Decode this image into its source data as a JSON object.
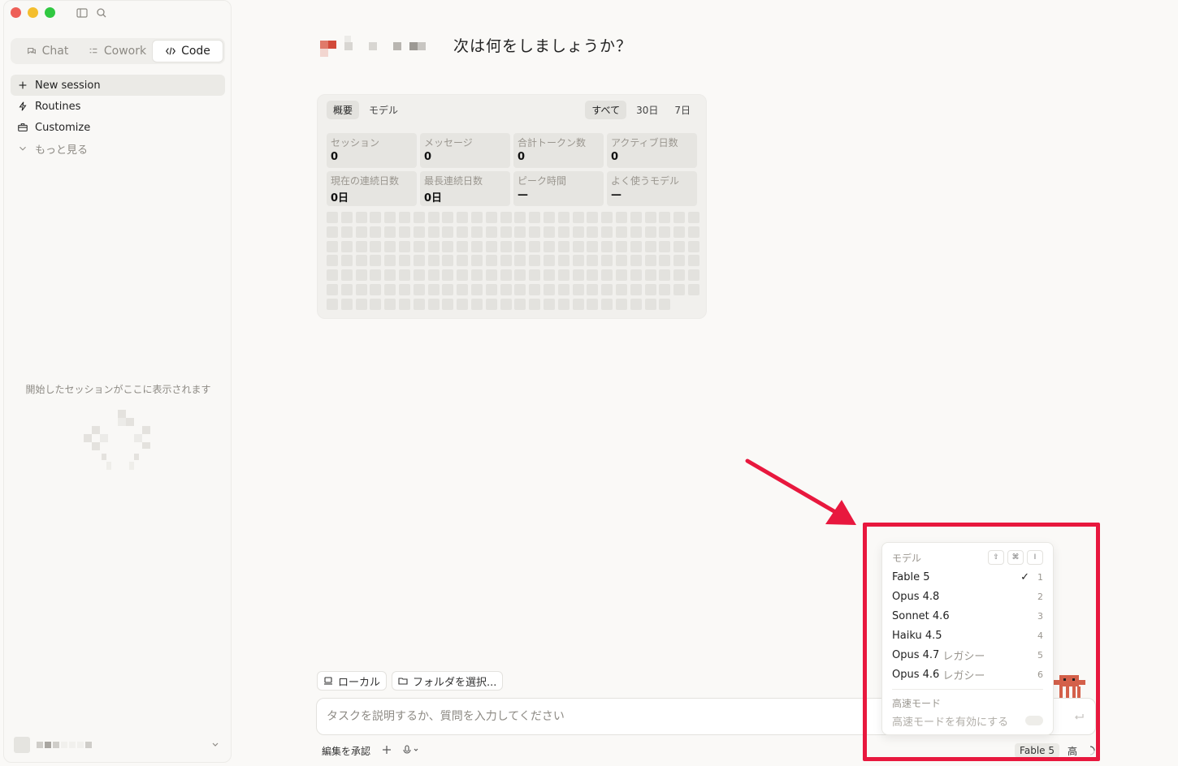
{
  "sidebar": {
    "tabs": [
      {
        "label": "Chat",
        "icon": "chat-icon"
      },
      {
        "label": "Cowork",
        "icon": "cowork-icon"
      },
      {
        "label": "Code",
        "icon": "code-icon"
      }
    ],
    "nav": [
      {
        "label": "New session",
        "icon": "plus-icon"
      },
      {
        "label": "Routines",
        "icon": "bolt-icon"
      },
      {
        "label": "Customize",
        "icon": "briefcase-icon"
      },
      {
        "label": "もっと見る",
        "icon": "chevron-down-icon"
      }
    ],
    "empty_text": "開始したセッションがここに表示されます"
  },
  "main": {
    "greeting": "次は何をしましょうか？",
    "stats": {
      "left_tabs": [
        "概要",
        "モデル"
      ],
      "right_tabs": [
        "すべて",
        "30日",
        "7日"
      ],
      "cards": [
        {
          "label": "セッション",
          "value": "0"
        },
        {
          "label": "メッセージ",
          "value": "0"
        },
        {
          "label": "合計トークン数",
          "value": "0"
        },
        {
          "label": "アクティブ日数",
          "value": "0"
        },
        {
          "label": "現在の連続日数",
          "value": "0日"
        },
        {
          "label": "最長連続日数",
          "value": "0日"
        },
        {
          "label": "ピーク時間",
          "value": "—"
        },
        {
          "label": "よく使うモデル",
          "value": "—"
        }
      ]
    },
    "chips": {
      "local": "ローカル",
      "folder": "フォルダを選択..."
    },
    "composer": {
      "placeholder": "タスクを説明するか、質問を入力してください"
    },
    "toolbar": {
      "accept_edits": "編集を承認",
      "model": "Fable 5",
      "effort": "高"
    }
  },
  "dropdown": {
    "title": "モデル",
    "keys": [
      "⇧",
      "⌘",
      "I"
    ],
    "items": [
      {
        "name": "Fable 5",
        "legacy": "",
        "num": "1",
        "checked": true
      },
      {
        "name": "Opus 4.8",
        "legacy": "",
        "num": "2"
      },
      {
        "name": "Sonnet 4.6",
        "legacy": "",
        "num": "3"
      },
      {
        "name": "Haiku 4.5",
        "legacy": "",
        "num": "4"
      },
      {
        "name": "Opus 4.7",
        "legacy": "レガシー",
        "num": "5"
      },
      {
        "name": "Opus 4.6",
        "legacy": "レガシー",
        "num": "6"
      }
    ],
    "fast_section": "高速モード",
    "fast_toggle": "高速モードを有効にする"
  },
  "colors": {
    "highlight": "#e8183e",
    "accent": "#d4604a"
  }
}
